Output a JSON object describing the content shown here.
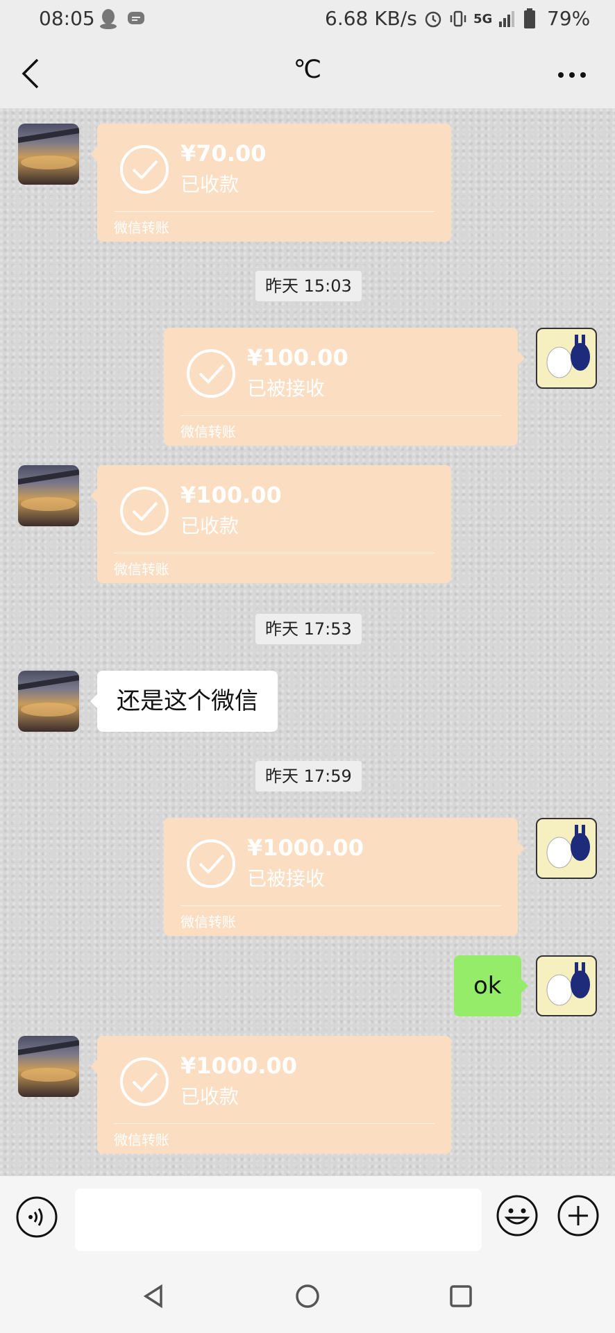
{
  "status_bar": {
    "time": "08:05",
    "network_speed": "6.68 KB/s",
    "network_type": "5G",
    "battery": "79%",
    "icons": [
      "qq-icon",
      "message-icon",
      "alarm-icon",
      "vibrate-icon",
      "signal-icon",
      "battery-icon"
    ]
  },
  "header": {
    "title": "℃",
    "back_icon": "chevron-left-icon",
    "more_icon": "more-dots-icon"
  },
  "messages": [
    {
      "type": "transfer",
      "side": "left",
      "amount": "¥70.00",
      "status": "已收款",
      "label": "微信转账"
    },
    {
      "type": "timestamp",
      "text": "昨天 15:03"
    },
    {
      "type": "transfer",
      "side": "right",
      "amount": "¥100.00",
      "status": "已被接收",
      "label": "微信转账"
    },
    {
      "type": "transfer",
      "side": "left",
      "amount": "¥100.00",
      "status": "已收款",
      "label": "微信转账"
    },
    {
      "type": "timestamp",
      "text": "昨天 17:53"
    },
    {
      "type": "text",
      "side": "left",
      "text": "还是这个微信"
    },
    {
      "type": "timestamp",
      "text": "昨天 17:59"
    },
    {
      "type": "transfer",
      "side": "right",
      "amount": "¥1000.00",
      "status": "已被接收",
      "label": "微信转账"
    },
    {
      "type": "text",
      "side": "right",
      "text": "ok"
    },
    {
      "type": "transfer",
      "side": "left",
      "amount": "¥1000.00",
      "status": "已收款",
      "label": "微信转账"
    }
  ],
  "input_bar": {
    "value": "",
    "voice_icon": "voice-icon",
    "emoji_icon": "emoji-icon",
    "plus_icon": "plus-icon"
  },
  "colors": {
    "transfer_bubble": "#fbdec2",
    "own_text_bubble": "#95ec69",
    "other_text_bubble": "#ffffff"
  }
}
